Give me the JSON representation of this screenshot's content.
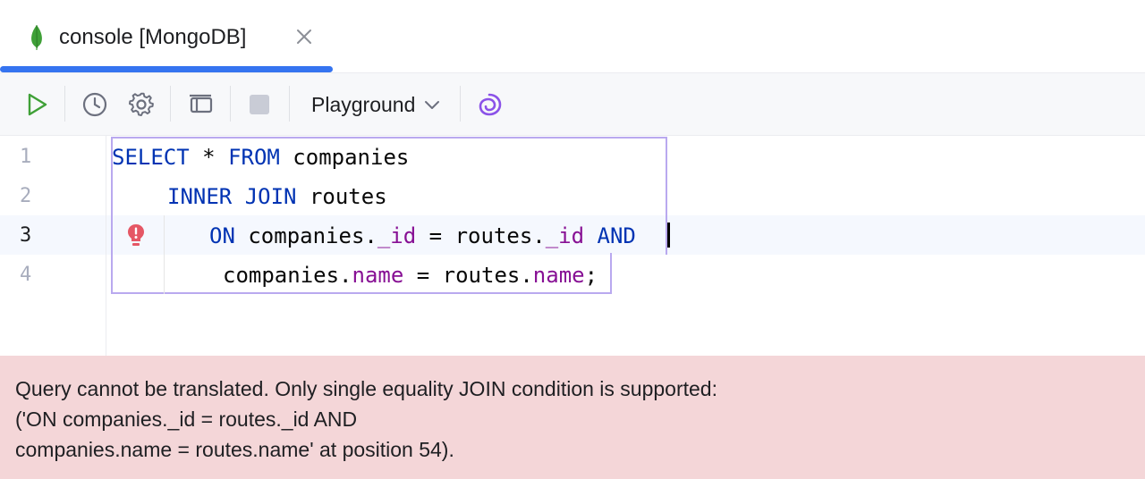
{
  "tab": {
    "title": "console [MongoDB]",
    "icon": "mongodb-leaf-icon",
    "accent": "#3574f0"
  },
  "toolbar": {
    "run_icon": "run-icon",
    "history_icon": "history-icon",
    "settings_icon": "gear-icon",
    "layout_icon": "panel-layout-icon",
    "stop_icon": "stop-icon",
    "mode_label": "Playground",
    "ai_icon": "ai-assistant-icon"
  },
  "editor": {
    "line_numbers": [
      "1",
      "2",
      "3",
      "4"
    ],
    "current_line": 3,
    "lines": [
      [
        {
          "t": "SELECT",
          "c": "kw"
        },
        {
          "t": " * ",
          "c": ""
        },
        {
          "t": "FROM",
          "c": "kw"
        },
        {
          "t": " companies",
          "c": ""
        }
      ],
      [
        {
          "t": "INNER",
          "c": "kw"
        },
        {
          "t": " ",
          "c": ""
        },
        {
          "t": "JOIN",
          "c": "kw"
        },
        {
          "t": " routes",
          "c": ""
        }
      ],
      [
        {
          "t": "ON",
          "c": "kw"
        },
        {
          "t": " companies.",
          "c": ""
        },
        {
          "t": "_id",
          "c": "fld"
        },
        {
          "t": " = routes.",
          "c": ""
        },
        {
          "t": "_id",
          "c": "fld"
        },
        {
          "t": " ",
          "c": ""
        },
        {
          "t": "AND",
          "c": "kw"
        }
      ],
      [
        {
          "t": "companies.",
          "c": ""
        },
        {
          "t": "name",
          "c": "fld"
        },
        {
          "t": " = routes.",
          "c": ""
        },
        {
          "t": "name",
          "c": "fld"
        },
        {
          "t": ";",
          "c": ""
        }
      ]
    ],
    "error_icon": "error-bulb-icon"
  },
  "error_panel": {
    "lines": [
      "Query cannot be translated. Only single equality JOIN condition is supported:",
      "('ON companies._id = routes._id AND",
      "companies.name = routes.name' at position 54)."
    ],
    "bg_color": "#f4d6d8"
  }
}
